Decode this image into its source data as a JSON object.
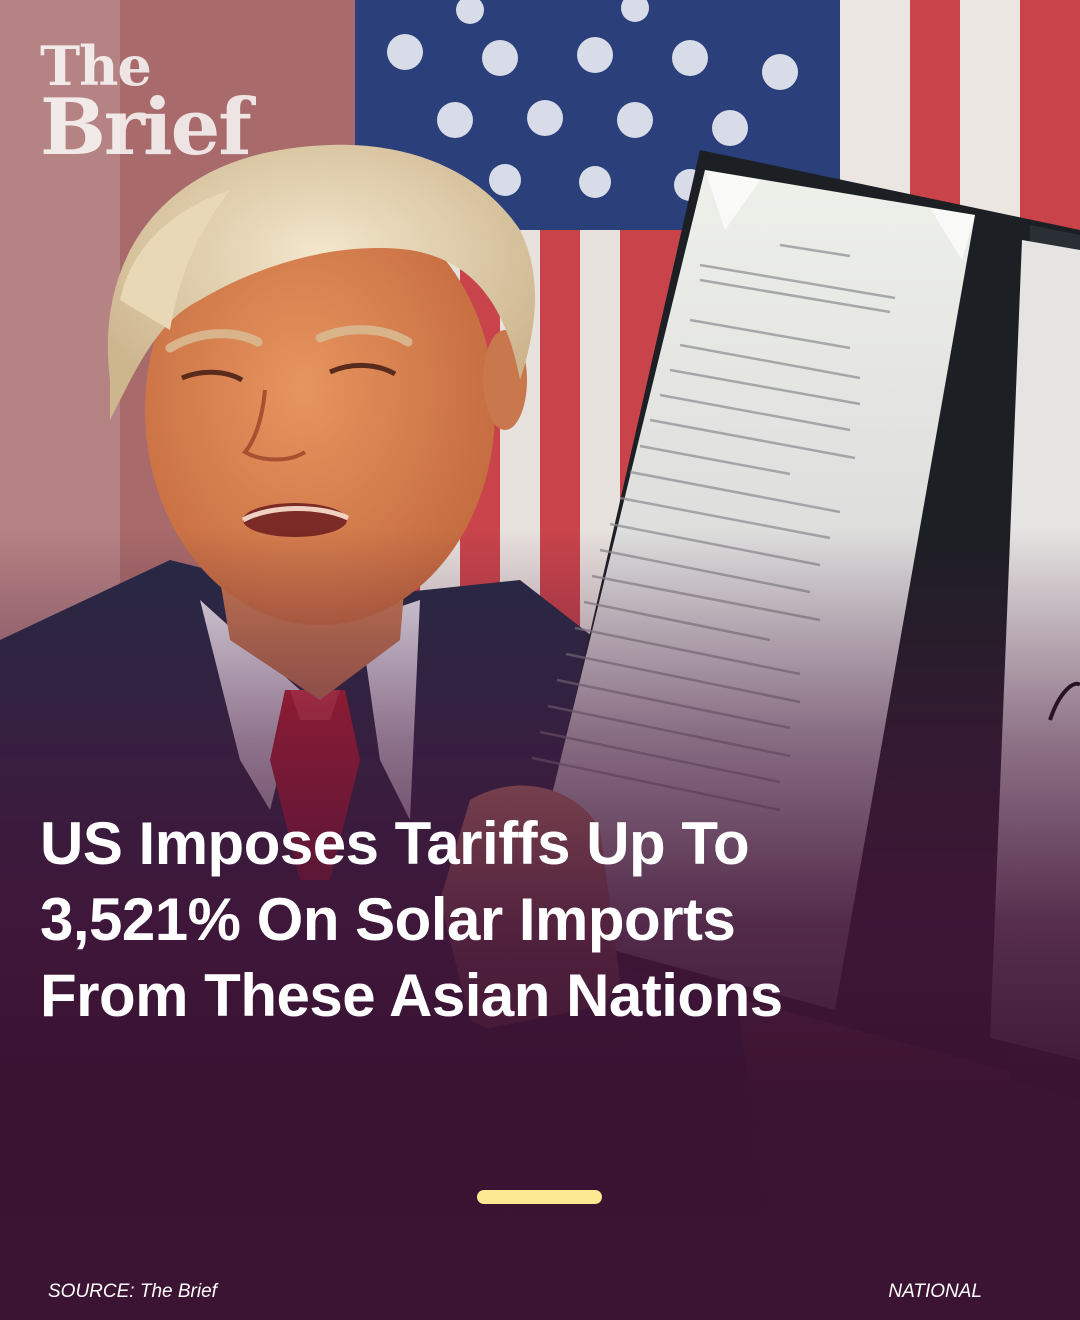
{
  "brand": {
    "logo_line1": "The",
    "logo_line2": "Brief"
  },
  "headline": {
    "line1": "US Imposes Tariffs Up To",
    "line2": "3,521% On Solar Imports",
    "line3": "From These Asian Nations"
  },
  "footer": {
    "source": "SOURCE: The Brief",
    "category": "NATIONAL"
  },
  "colors": {
    "accent": "#fbe891",
    "overlay": "#3b1433",
    "text": "#ffffff"
  },
  "image": {
    "subject_icon": "news-photo-man-holding-signed-document"
  }
}
